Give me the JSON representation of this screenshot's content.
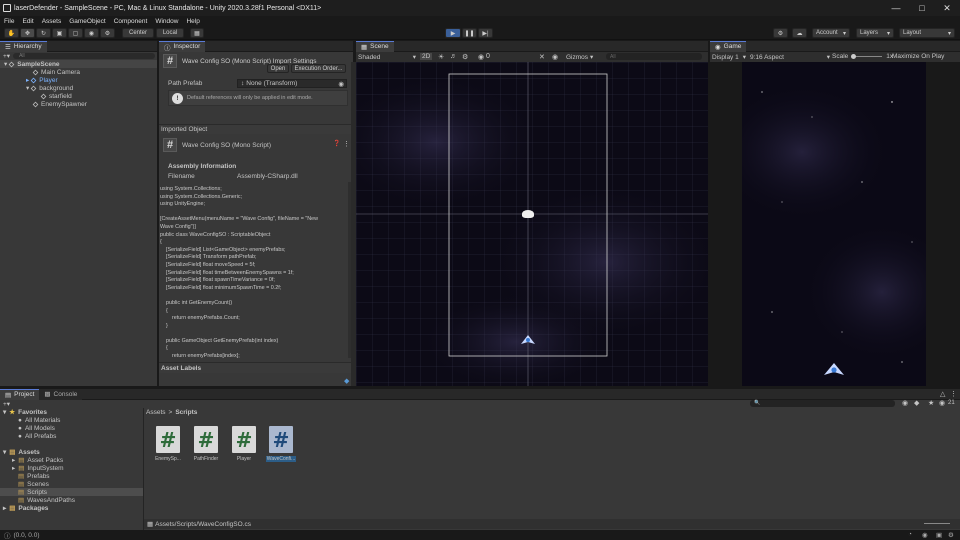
{
  "window": {
    "title": "laserDefender - SampleScene - PC, Mac & Linux Standalone - Unity 2020.3.28f1 Personal <DX11>"
  },
  "menu": [
    "File",
    "Edit",
    "Assets",
    "GameObject",
    "Component",
    "Window",
    "Help"
  ],
  "toolbar": {
    "pivot": "Center",
    "space": "Local",
    "account": "Account",
    "layers": "Layers",
    "layout": "Layout"
  },
  "hierarchy": {
    "tab": "Hierarchy",
    "search_placeholder": "All",
    "items": [
      {
        "label": "SampleScene",
        "depth": 0
      },
      {
        "label": "Main Camera",
        "depth": 1
      },
      {
        "label": "Player",
        "depth": 1
      },
      {
        "label": "background",
        "depth": 1
      },
      {
        "label": "starfield",
        "depth": 2
      },
      {
        "label": "EnemySpawner",
        "depth": 1
      }
    ]
  },
  "inspector": {
    "tab": "Inspector",
    "header_title": "Wave Config SO (Mono Script) Import Settings",
    "open_button": "Open",
    "execution_order_button": "Execution Order...",
    "path_prefab_label": "Path Prefab",
    "path_prefab_value": "None (Transform)",
    "warning": "Default references will only be applied in edit mode.",
    "imported_object_label": "Imported Object",
    "imported_title": "Wave Config SO (Mono Script)",
    "assembly_info": "Assembly Information",
    "filename_label": "Filename",
    "filename_value": "Assembly-CSharp.dll",
    "code": "using System.Collections;\nusing System.Collections.Generic;\nusing UnityEngine;\n\n[CreateAssetMenu(menuName = \"Wave Config\", fileName = \"New\nWave Config\")]\npublic class WaveConfigSO : ScriptableObject\n{\n    [SerializeField] List<GameObject> enemyPrefabs;\n    [SerializeField] Transform pathPrefab;\n    [SerializeField] float moveSpeed = 5f;\n    [SerializeField] float timeBetweenEnemySpawns = 1f;\n    [SerializeField] float spawnTimeVariance = 0f;\n    [SerializeField] float minimumSpawnTime = 0.2f;\n\n    public int GetEnemyCount()\n    {\n        return enemyPrefabs.Count;\n    }\n\n    public GameObject GetEnemyPrefab(int index)\n    {\n        return enemyPrefabs[index];",
    "asset_labels": "Asset Labels"
  },
  "scene": {
    "tab": "Scene",
    "shading": "Shaded",
    "mode_2d": "2D",
    "gizmos": "Gizmos",
    "search_placeholder": "All",
    "layer_count": "0"
  },
  "game": {
    "tab": "Game",
    "display": "Display 1",
    "aspect": "9:16 Aspect",
    "scale_label": "Scale",
    "scale_value": "1x",
    "maximize": "Maximize On Play"
  },
  "project": {
    "tab_project": "Project",
    "tab_console": "Console",
    "favorites": "Favorites",
    "fav_items": [
      "All Materials",
      "All Models",
      "All Prefabs"
    ],
    "assets": "Assets",
    "asset_folders": [
      "Asset Packs",
      "InputSystem",
      "Prefabs",
      "Scenes",
      "Scripts",
      "WavesAndPaths"
    ],
    "packages": "Packages",
    "breadcrumb_root": "Assets",
    "breadcrumb_sep": ">",
    "breadcrumb_current": "Scripts",
    "files": [
      "EnemySp...",
      "PathFinder",
      "Player",
      "WaveConfi..."
    ],
    "selected_path": "Assets/Scripts/WaveConfigSO.cs",
    "hidden_count": "21"
  },
  "status": {
    "coords": "(0.0, 0.0)"
  },
  "colors": {
    "accent": "#5a7bd6",
    "selection": "#2c5d87",
    "bg": "#383838",
    "dark": "#191919",
    "space": "#0c0a16"
  }
}
